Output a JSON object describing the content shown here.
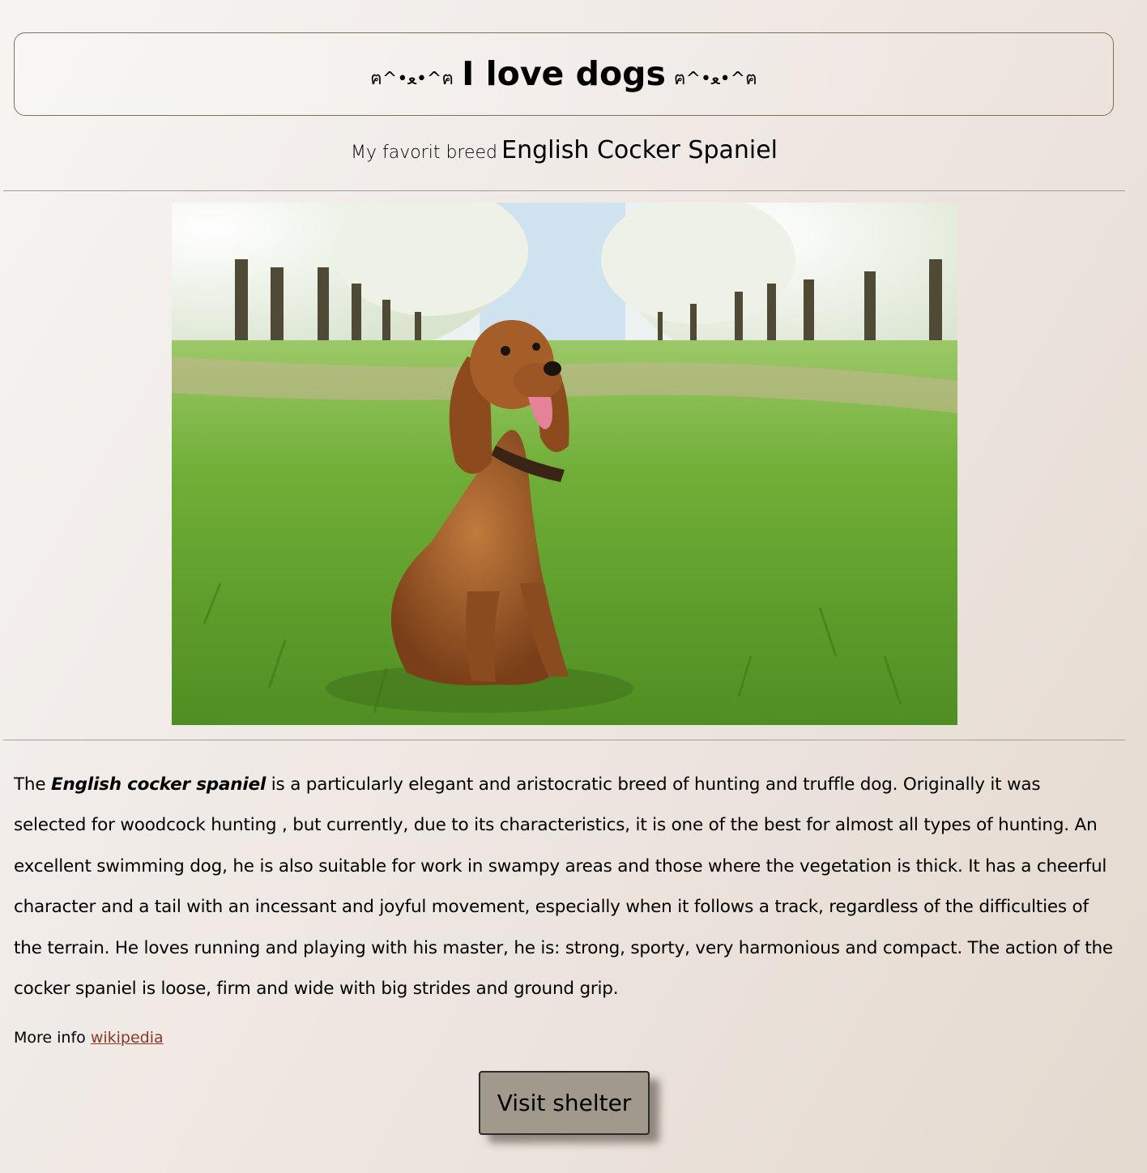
{
  "header": {
    "kaomoji_left": "ฅ^•ﻌ•^ฅ",
    "title": "I love dogs",
    "kaomoji_right": "ฅ^•ﻌ•^ฅ"
  },
  "subtitle": {
    "prefix": "My favorit breed",
    "breed": "English Cocker Spaniel"
  },
  "photo": {
    "alt": "English cocker spaniel sitting in grass"
  },
  "description": {
    "lead": "The",
    "highlight": "English cocker spaniel",
    "body": "is a particularly elegant and aristocratic breed of hunting and truffle dog. Originally it was selected for woodcock hunting , but currently, due to its characteristics, it is one of the best for almost all types of hunting. An excellent swimming dog, he is also suitable for work in swampy areas and those where the vegetation is thick. It has a cheerful character and a tail with an incessant and joyful movement, especially when it follows a track, regardless of the difficulties of the terrain. He loves running and playing with his master, he is: strong, sporty, very harmonious and compact. The action of the cocker spaniel is loose, firm and wide with big strides and ground grip."
  },
  "more_info": {
    "label": "More info",
    "link_text": "wikipedia"
  },
  "cta": {
    "label": "Visit shelter"
  },
  "colors": {
    "background_light": "#f6f4f2",
    "background_dark": "#e4d9cf",
    "border": "#7d7258",
    "button_bg": "#a1998b",
    "link": "#8a3a2a"
  }
}
